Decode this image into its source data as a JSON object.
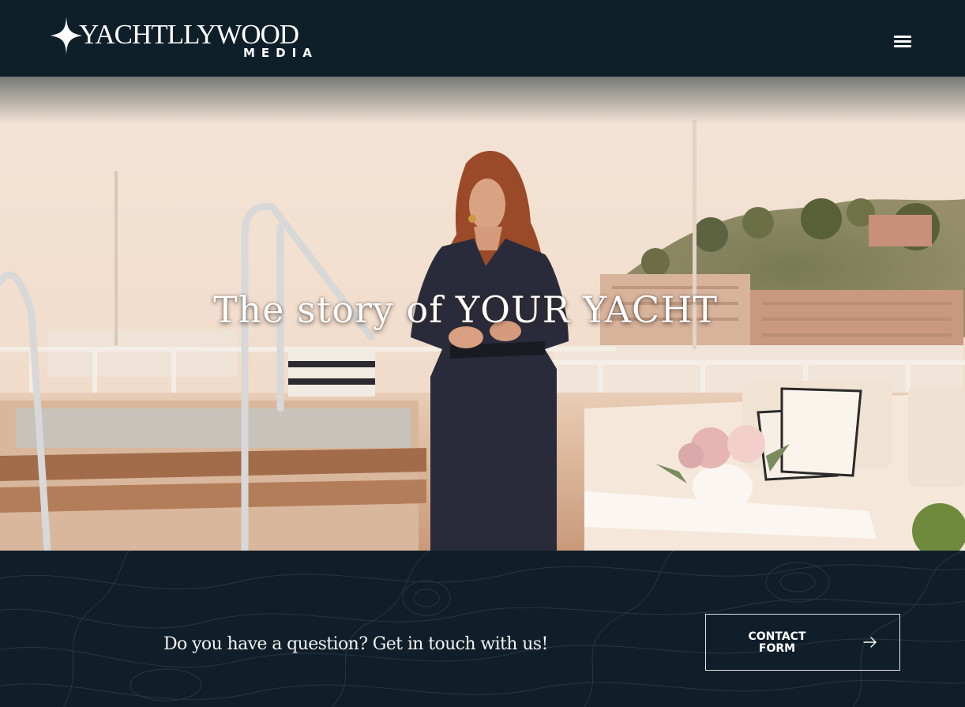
{
  "header": {
    "logo": {
      "name": "YACHTLLYWOOD",
      "tagline": "MEDIA"
    },
    "menu_icon": "hamburger-menu-icon"
  },
  "hero": {
    "caption_prefix": "The story of",
    "caption_highlight": "YOUR YACHT"
  },
  "contact": {
    "prompt": "Do you have a question? Get in touch with us!",
    "button_label_line1": "CONTACT",
    "button_label_line2": "FORM",
    "button_icon": "arrow-right-icon"
  },
  "colors": {
    "header_background": "#0f1f29",
    "footer_background": "#0f1e28",
    "text": "#ffffff"
  }
}
